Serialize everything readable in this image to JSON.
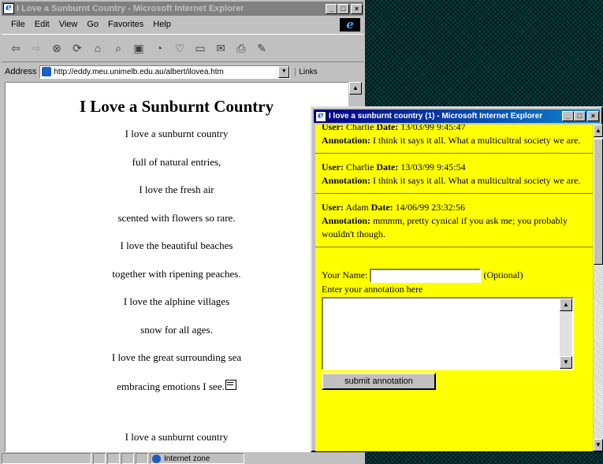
{
  "main_window": {
    "title": "I Love a Sunburnt Country - Microsoft Internet Explorer",
    "menus": [
      "File",
      "Edit",
      "View",
      "Go",
      "Favorites",
      "Help"
    ],
    "address_label": "Address",
    "address_url": "http://eddy.meu.unimelb.edu.au/albert/ilovea.htm",
    "links_label": "Links",
    "page": {
      "heading": "I Love a Sunburnt Country",
      "lines": [
        "I love a sunburnt country",
        "full of natural entries,",
        "I love the fresh air",
        "scented with flowers so rare.",
        "I love the beautiful beaches",
        "together with ripening peaches.",
        "I love the alphine villages",
        "snow for all ages.",
        "I love the great surrounding sea",
        "embracing emotions I see."
      ],
      "repeat_line": "I love a sunburnt country"
    },
    "status_zone": "Internet zone"
  },
  "popup_window": {
    "title": "I love a sunburnt country (1) - Microsoft Internet Explorer",
    "user_label": "User:",
    "date_label": "Date:",
    "annotation_label": "Annotation:",
    "annotations": [
      {
        "user": "Charlie",
        "date": "13/03/99 9:45:47",
        "text": "I think it says it all. What a multicultral society we are."
      },
      {
        "user": "Charlie",
        "date": "13/03/99 9:45:54",
        "text": "I think it says it all. What a multicultral society we are."
      },
      {
        "user": "Adam",
        "date": "14/06/99 23:32:56",
        "text": "mmmm, pretty cynical if you ask me; you probably wouldn't though."
      }
    ],
    "form": {
      "name_label": "Your Name:",
      "name_value": "",
      "optional_label": "(Optional)",
      "annotation_prompt": "Enter your annotation here",
      "annotation_value": "",
      "submit_label": "submit annotation"
    }
  }
}
